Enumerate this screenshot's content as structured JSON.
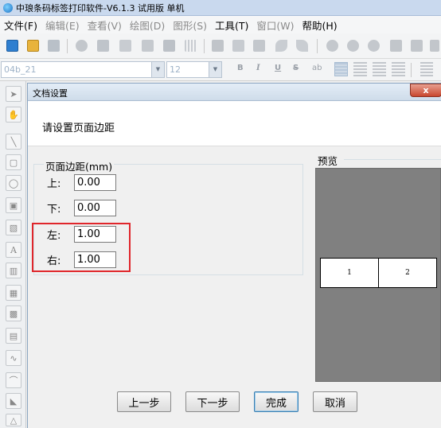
{
  "app": {
    "title": "中琅条码标签打印软件-V6.1.3 试用版 单机"
  },
  "menu": [
    {
      "label": "文件(F)",
      "enabled": true
    },
    {
      "label": "编辑(E)",
      "enabled": false
    },
    {
      "label": "查看(V)",
      "enabled": false
    },
    {
      "label": "绘图(D)",
      "enabled": false
    },
    {
      "label": "图形(S)",
      "enabled": false
    },
    {
      "label": "工具(T)",
      "enabled": true
    },
    {
      "label": "窗口(W)",
      "enabled": false
    },
    {
      "label": "帮助(H)",
      "enabled": true
    }
  ],
  "format_toolbar": {
    "font_name": "04b_21",
    "font_size": "12",
    "bold": "B",
    "italic": "I",
    "underline": "U",
    "strike": "S"
  },
  "left_tools": [
    "A"
  ],
  "dialog": {
    "title": "文档设置",
    "close_label": "x",
    "prompt": "请设置页面边距",
    "margins_group": {
      "legend": "页面边距(mm)",
      "top_label": "上:",
      "top_value": "0.00",
      "bottom_label": "下:",
      "bottom_value": "0.00",
      "left_label": "左:",
      "left_value": "1.00",
      "right_label": "右:",
      "right_value": "1.00"
    },
    "preview": {
      "legend": "预览",
      "labels": [
        "1",
        "2"
      ]
    },
    "buttons": {
      "prev": "上一步",
      "next": "下一步",
      "finish": "完成",
      "cancel": "取消"
    }
  },
  "colors": {
    "highlight_box": "#e0262b",
    "preview_background": "#808080",
    "close_button": "#c9472f"
  }
}
